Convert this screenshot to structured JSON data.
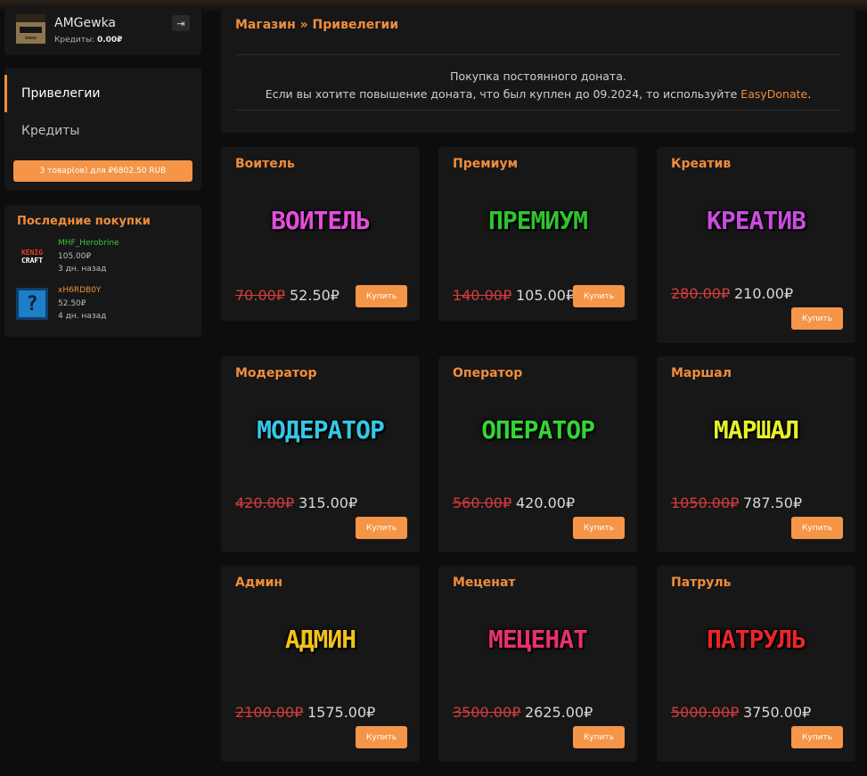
{
  "profile": {
    "username": "AMGewka",
    "credits_label": "Кредиты:",
    "credits_value": "0.00₽",
    "logout_icon": "logout-icon"
  },
  "nav": {
    "items": [
      {
        "label": "Привелегии",
        "active": true
      },
      {
        "label": "Кредиты",
        "active": false
      }
    ],
    "cart_button": "3 товар(ов) для ₽6802.50 RUB"
  },
  "recent": {
    "title": "Последние покупки",
    "purchases": [
      {
        "name": "MHF_Herobrine",
        "name_color": "#3cc43c",
        "price": "105.00₽",
        "time": "3 дн. назад",
        "icon_line1": "KENIG",
        "icon_line2": "CRAFT"
      },
      {
        "name": "xH6RDB0Y",
        "name_color": "#f08d3c",
        "price": "52.50₽",
        "time": "4 дн. назад",
        "icon_text": "?"
      }
    ]
  },
  "header": {
    "breadcrumb": "Магазин » Привелегии",
    "info_line1": "Покупка постоянного доната.",
    "info_line2": "Если вы хотите повышение доната, что был куплен до 09.2024, то используйте",
    "info_link": "EasyDonate",
    "info_end": "."
  },
  "buy_label": "Купить",
  "products": [
    {
      "title": "Воитель",
      "logo": "ВОИТЕЛЬ",
      "logo_color": "#e64ddc",
      "old_price": "70.00₽",
      "new_price": "52.50₽"
    },
    {
      "title": "Премиум",
      "logo": "ПРЕМИУМ",
      "logo_color": "#2fc42f",
      "old_price": "140.00₽",
      "new_price": "105.00₽"
    },
    {
      "title": "Креатив",
      "logo": "КРЕАТИВ",
      "logo_color": "#c94dde",
      "old_price": "280.00₽",
      "new_price": "210.00₽"
    },
    {
      "title": "Модератор",
      "logo": "МОДЕРАТОР",
      "logo_color": "#35c7e6",
      "old_price": "420.00₽",
      "new_price": "315.00₽"
    },
    {
      "title": "Оператор",
      "logo": "ОПЕРАТОР",
      "logo_color": "#35d435",
      "old_price": "560.00₽",
      "new_price": "420.00₽"
    },
    {
      "title": "Маршал",
      "logo": "МАРШАЛ",
      "logo_color": "#e8ef2a",
      "old_price": "1050.00₽",
      "new_price": "787.50₽"
    },
    {
      "title": "Админ",
      "logo": "АДМИН",
      "logo_color": "#f2c21c",
      "old_price": "2100.00₽",
      "new_price": "1575.00₽"
    },
    {
      "title": "Меценат",
      "logo": "МЕЦЕНАТ",
      "logo_color": "#e8306f",
      "old_price": "3500.00₽",
      "new_price": "2625.00₽"
    },
    {
      "title": "Патруль",
      "logo": "ПАТРУЛЬ",
      "logo_color": "#e8262a",
      "old_price": "5000.00₽",
      "new_price": "3750.00₽"
    }
  ]
}
